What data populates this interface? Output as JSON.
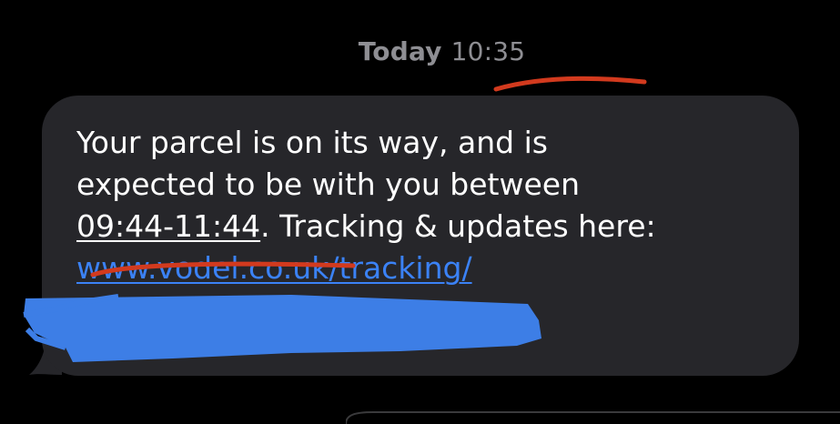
{
  "header": {
    "timestamp_day": "Today",
    "timestamp_time": "10:35"
  },
  "message": {
    "line1": "Your parcel is on its way, and is",
    "line2": "expected to be with you between",
    "time_window": "09:44-11:44",
    "line3_rest": ". Tracking & updates here:",
    "link_text": "www.vodel.co.uk/tracking/"
  },
  "colors": {
    "background": "#000000",
    "bubble": "#26262a",
    "text": "#ffffff",
    "timestamp": "#8e8e93",
    "link": "#3b82f6",
    "annotation_red": "#d23a1e",
    "redaction_blue": "#3d7ee6"
  }
}
